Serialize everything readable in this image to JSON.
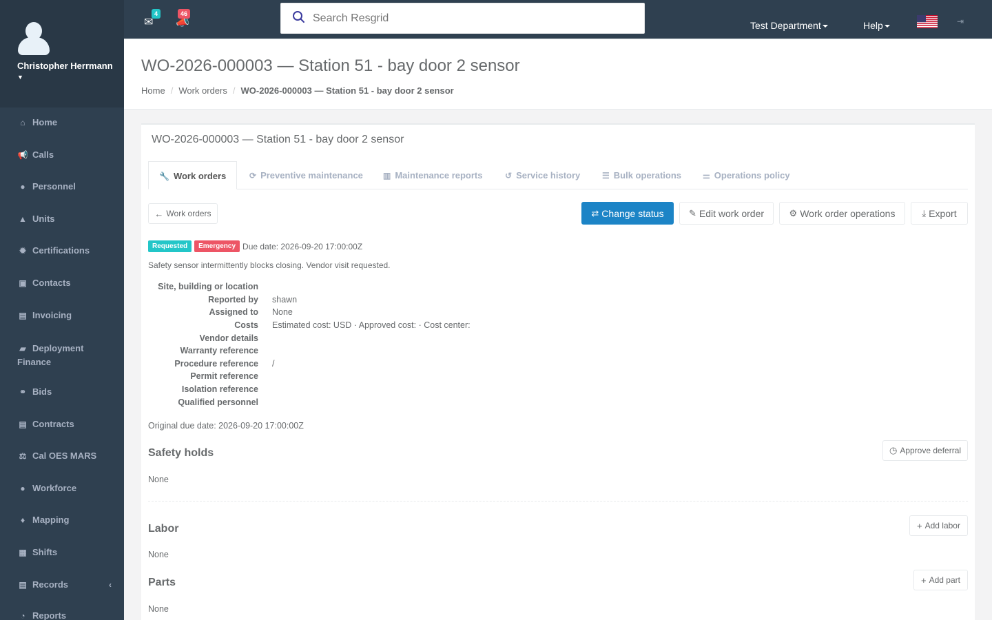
{
  "user": {
    "name": "Christopher Herrmann"
  },
  "sidebar": {
    "items": [
      {
        "label": "Home",
        "icon": "home-icon"
      },
      {
        "label": "Calls",
        "icon": "bullhorn-icon"
      },
      {
        "label": "Personnel",
        "icon": "user-icon"
      },
      {
        "label": "Units",
        "icon": "truck-icon"
      },
      {
        "label": "Certifications",
        "icon": "certificate-icon"
      },
      {
        "label": "Contacts",
        "icon": "address-book-icon"
      },
      {
        "label": "Invoicing",
        "icon": "file-icon"
      },
      {
        "label": "Deployment Finance",
        "icon": "truck-icon"
      },
      {
        "label": "Bids",
        "icon": "handshake-icon"
      },
      {
        "label": "Contracts",
        "icon": "file-icon"
      },
      {
        "label": "Cal OES MARS",
        "icon": "balance-icon"
      },
      {
        "label": "Workforce",
        "icon": "users-icon"
      },
      {
        "label": "Mapping",
        "icon": "map-marker-icon"
      },
      {
        "label": "Shifts",
        "icon": "calendar-icon"
      },
      {
        "label": "Records",
        "icon": "file-icon",
        "arrow": "‹"
      },
      {
        "label": "Reports",
        "icon": "chart-icon"
      }
    ]
  },
  "topbar": {
    "messages_count": "4",
    "calls_count": "46",
    "search_placeholder": "Search Resgrid",
    "department": "Test Department",
    "help": "Help",
    "colors": {
      "bg": "#2f4050",
      "badge_messages": "#23c6c8",
      "badge_calls": "#ed5565"
    }
  },
  "page": {
    "title": "WO-2026-000003 — Station 51 - bay door 2 sensor",
    "breadcrumb": [
      "Home",
      "Work orders",
      "WO-2026-000003 — Station 51 - bay door 2 sensor"
    ]
  },
  "panel": {
    "title": "WO-2026-000003 — Station 51 - bay door 2 sensor",
    "tabs": [
      "Work orders",
      "Preventive maintenance",
      "Maintenance reports",
      "Service history",
      "Bulk operations",
      "Operations policy"
    ],
    "back_button": "Work orders",
    "actions": {
      "change_status": "Change status",
      "edit": "Edit work order",
      "operations": "Work order operations",
      "export": "Export"
    },
    "status_badge": "Requested",
    "priority_badge": "Emergency",
    "due_date": "Due date: 2026-09-20 17:00:00Z",
    "description": "Safety sensor intermittently blocks closing. Vendor visit requested.",
    "details": [
      {
        "label": "Site, building or location",
        "value": ""
      },
      {
        "label": "Reported by",
        "value": "shawn"
      },
      {
        "label": "Assigned to",
        "value": "None"
      },
      {
        "label": "Costs",
        "value": "Estimated cost: USD · Approved cost: · Cost center:"
      },
      {
        "label": "Vendor details",
        "value": ""
      },
      {
        "label": "Warranty reference",
        "value": ""
      },
      {
        "label": "Procedure reference",
        "value": "/"
      },
      {
        "label": "Permit reference",
        "value": ""
      },
      {
        "label": "Isolation reference",
        "value": ""
      },
      {
        "label": "Qualified personnel",
        "value": ""
      }
    ],
    "original_due": "Original due date: 2026-09-20 17:00:00Z",
    "safety": {
      "title": "Safety holds",
      "action": "Approve deferral",
      "empty": "None"
    },
    "labor": {
      "title": "Labor",
      "action": "Add labor",
      "empty": "None"
    },
    "parts": {
      "title": "Parts",
      "action": "Add part",
      "empty": "None"
    }
  }
}
